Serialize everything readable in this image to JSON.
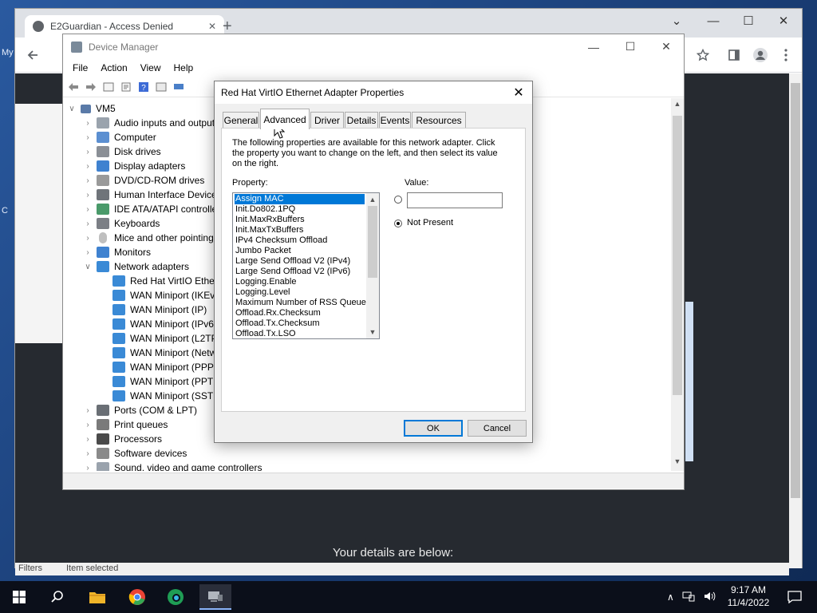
{
  "desktop": {
    "left_text_1": "My",
    "left_text_2": "C"
  },
  "chrome": {
    "tab_title": "E2Guardian - Access Denied",
    "tab_close": "✕",
    "new_tab": "+",
    "ctrl_chevron": "⌄",
    "ctrl_minimize": "—",
    "ctrl_maximize": "☐",
    "ctrl_close": "✕",
    "page_heading": "Your details are below:",
    "page_status_left": "Filters",
    "page_status_mid": "Item selected"
  },
  "device_manager": {
    "title": "Device Manager",
    "ctrl_minimize": "—",
    "ctrl_maximize": "☐",
    "ctrl_close": "✕",
    "menu": [
      "File",
      "Action",
      "View",
      "Help"
    ],
    "tree": [
      {
        "label": "VM5",
        "chev": "∨",
        "level": 0
      },
      {
        "label": "Audio inputs and outputs",
        "chev": "›",
        "level": 1
      },
      {
        "label": "Computer",
        "chev": "›",
        "level": 1
      },
      {
        "label": "Disk drives",
        "chev": "›",
        "level": 1
      },
      {
        "label": "Display adapters",
        "chev": "›",
        "level": 1
      },
      {
        "label": "DVD/CD-ROM drives",
        "chev": "›",
        "level": 1
      },
      {
        "label": "Human Interface Devices",
        "chev": "›",
        "level": 1
      },
      {
        "label": "IDE ATA/ATAPI controllers",
        "chev": "›",
        "level": 1
      },
      {
        "label": "Keyboards",
        "chev": "›",
        "level": 1
      },
      {
        "label": "Mice and other pointing devices",
        "chev": "›",
        "level": 1
      },
      {
        "label": "Monitors",
        "chev": "›",
        "level": 1
      },
      {
        "label": "Network adapters",
        "chev": "∨",
        "level": 1
      },
      {
        "label": "Red Hat VirtIO Ethernet Adapter",
        "chev": "",
        "level": 2
      },
      {
        "label": "WAN Miniport (IKEv2)",
        "chev": "",
        "level": 2
      },
      {
        "label": "WAN Miniport (IP)",
        "chev": "",
        "level": 2
      },
      {
        "label": "WAN Miniport (IPv6)",
        "chev": "",
        "level": 2
      },
      {
        "label": "WAN Miniport (L2TP)",
        "chev": "",
        "level": 2
      },
      {
        "label": "WAN Miniport (Network Monitor)",
        "chev": "",
        "level": 2
      },
      {
        "label": "WAN Miniport (PPPOE)",
        "chev": "",
        "level": 2
      },
      {
        "label": "WAN Miniport (PPTP)",
        "chev": "",
        "level": 2
      },
      {
        "label": "WAN Miniport (SSTP)",
        "chev": "",
        "level": 2
      },
      {
        "label": "Ports (COM & LPT)",
        "chev": "›",
        "level": 1
      },
      {
        "label": "Print queues",
        "chev": "›",
        "level": 1
      },
      {
        "label": "Processors",
        "chev": "›",
        "level": 1
      },
      {
        "label": "Software devices",
        "chev": "›",
        "level": 1
      },
      {
        "label": "Sound, video and game controllers",
        "chev": "›",
        "level": 1
      }
    ],
    "scroll_up": "▲",
    "scroll_down": "▼"
  },
  "dialog": {
    "title": "Red Hat VirtIO Ethernet Adapter Properties",
    "close": "✕",
    "tabs": [
      "General",
      "Advanced",
      "Driver",
      "Details",
      "Events",
      "Resources"
    ],
    "active_tab": "Advanced",
    "description": "The following properties are available for this network adapter. Click the property you want to change on the left, and then select its value on the right.",
    "property_label": "Property:",
    "value_label": "Value:",
    "properties": [
      "Assign MAC",
      "Init.Do802.1PQ",
      "Init.MaxRxBuffers",
      "Init.MaxTxBuffers",
      "IPv4 Checksum Offload",
      "Jumbo Packet",
      "Large Send Offload V2 (IPv4)",
      "Large Send Offload V2 (IPv6)",
      "Logging.Enable",
      "Logging.Level",
      "Maximum Number of RSS Queues",
      "Offload.Rx.Checksum",
      "Offload.Tx.Checksum",
      "Offload.Tx.LSO"
    ],
    "selected_property": "Assign MAC",
    "value_input": "",
    "not_present_label": "Not Present",
    "not_present_selected": true,
    "scroll_up": "▲",
    "scroll_down": "▼",
    "ok": "OK",
    "cancel": "Cancel"
  },
  "taskbar": {
    "time": "9:17 AM",
    "date": "11/4/2022",
    "tray_chevron": "∧"
  },
  "colors": {
    "selection": "#0078d7",
    "taskbar": "#0b0f1a",
    "folder": "#f0b429",
    "chrome_red": "#ea4335",
    "chrome_green": "#34a853",
    "chrome_yellow": "#fbbc05",
    "chrome_blue": "#4285f4"
  }
}
